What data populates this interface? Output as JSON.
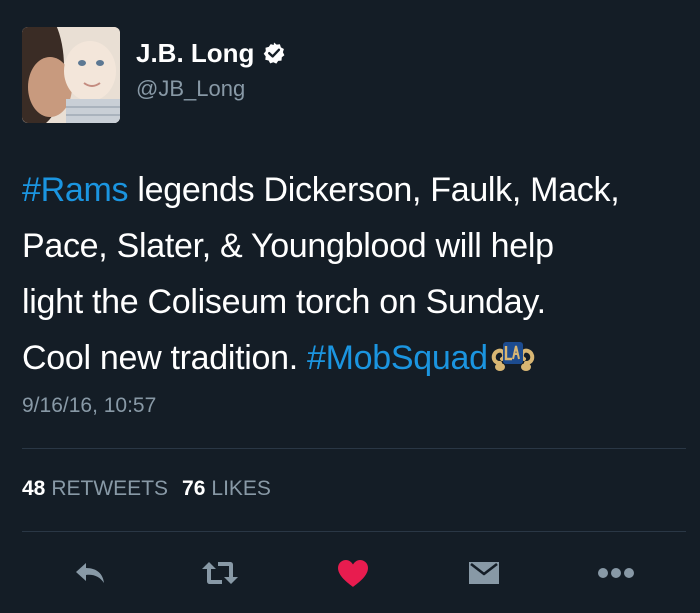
{
  "user": {
    "display_name": "J.B. Long",
    "username": "@JB_Long",
    "verified": true
  },
  "tweet": {
    "lines": [
      [
        {
          "text": "#Rams",
          "hashtag": true
        },
        {
          "text": " legends Dickerson, Faulk, Mack,",
          "hashtag": false
        }
      ],
      [
        {
          "text": "Pace, Slater, & Youngblood will help",
          "hashtag": false
        }
      ],
      [
        {
          "text": "light the Coliseum torch on Sunday.",
          "hashtag": false
        }
      ],
      [
        {
          "text": "Cool new tradition. ",
          "hashtag": false
        },
        {
          "text": "#MobSquad",
          "hashtag": true
        }
      ]
    ],
    "emoji_icon": "la-rams-hashflag-icon",
    "timestamp": "9/16/16, 10:57"
  },
  "stats": {
    "retweets_count": "48",
    "retweets_label": "RETWEETS",
    "likes_count": "76",
    "likes_label": "LIKES"
  },
  "actions": {
    "icons": [
      "reply-icon",
      "retweet-icon",
      "like-heart-icon",
      "direct-message-icon",
      "more-icon"
    ],
    "icon_color": "#8899a6",
    "like_color": "#e81c4f"
  },
  "colors": {
    "background": "#141d26",
    "hashtag": "#1b95e0",
    "secondary_text": "#8899a6"
  }
}
